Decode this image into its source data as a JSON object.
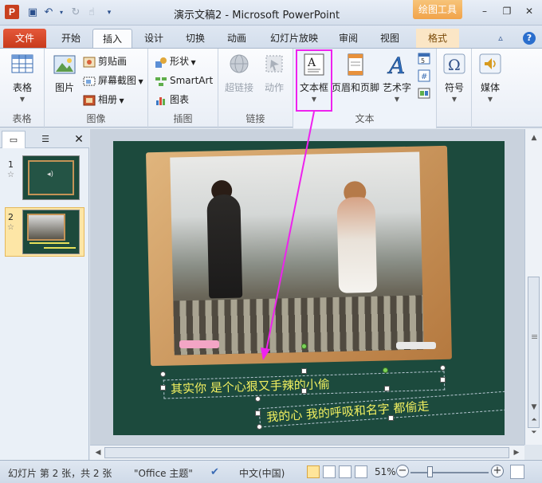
{
  "window": {
    "title": "演示文稿2 - Microsoft PowerPoint",
    "context_tab_title": "绘图工具",
    "app_letter": "P"
  },
  "tabs": [
    {
      "label": "文件"
    },
    {
      "label": "开始"
    },
    {
      "label": "插入"
    },
    {
      "label": "设计"
    },
    {
      "label": "切换"
    },
    {
      "label": "动画"
    },
    {
      "label": "幻灯片放映"
    },
    {
      "label": "审阅"
    },
    {
      "label": "视图"
    },
    {
      "label": "格式"
    }
  ],
  "ribbon": {
    "groups": {
      "tables": "表格",
      "images": "图像",
      "illustrations": "插图",
      "links": "链接",
      "text": "文本"
    },
    "buttons": {
      "table": "表格",
      "picture": "图片",
      "clipart": "剪贴画",
      "screenshot": "屏幕截图",
      "album": "相册",
      "shapes": "形状",
      "smartart": "SmartArt",
      "chart": "图表",
      "hyperlink": "超链接",
      "action": "动作",
      "textbox": "文本框",
      "header_footer": "页眉和页脚",
      "wordart": "艺术字",
      "symbols": "符号",
      "media": "媒体"
    }
  },
  "panel": {
    "slides": [
      {
        "number": "1"
      },
      {
        "number": "2"
      }
    ]
  },
  "slide": {
    "line1": "其实你 是个心狠又手辣的小偷",
    "line2": "我的心 我的呼吸和名字 都偷走"
  },
  "status": {
    "slide_info": "幻灯片 第 2 张，共 2 张",
    "theme": "\"Office 主题\"",
    "language": "中文(中国)",
    "zoom": "51%"
  },
  "colors": {
    "annotation": "#ee22ee",
    "slide_bg": "#1c4a3d",
    "handwriting": "#f2f060",
    "file_tab": "#c83b1c"
  }
}
